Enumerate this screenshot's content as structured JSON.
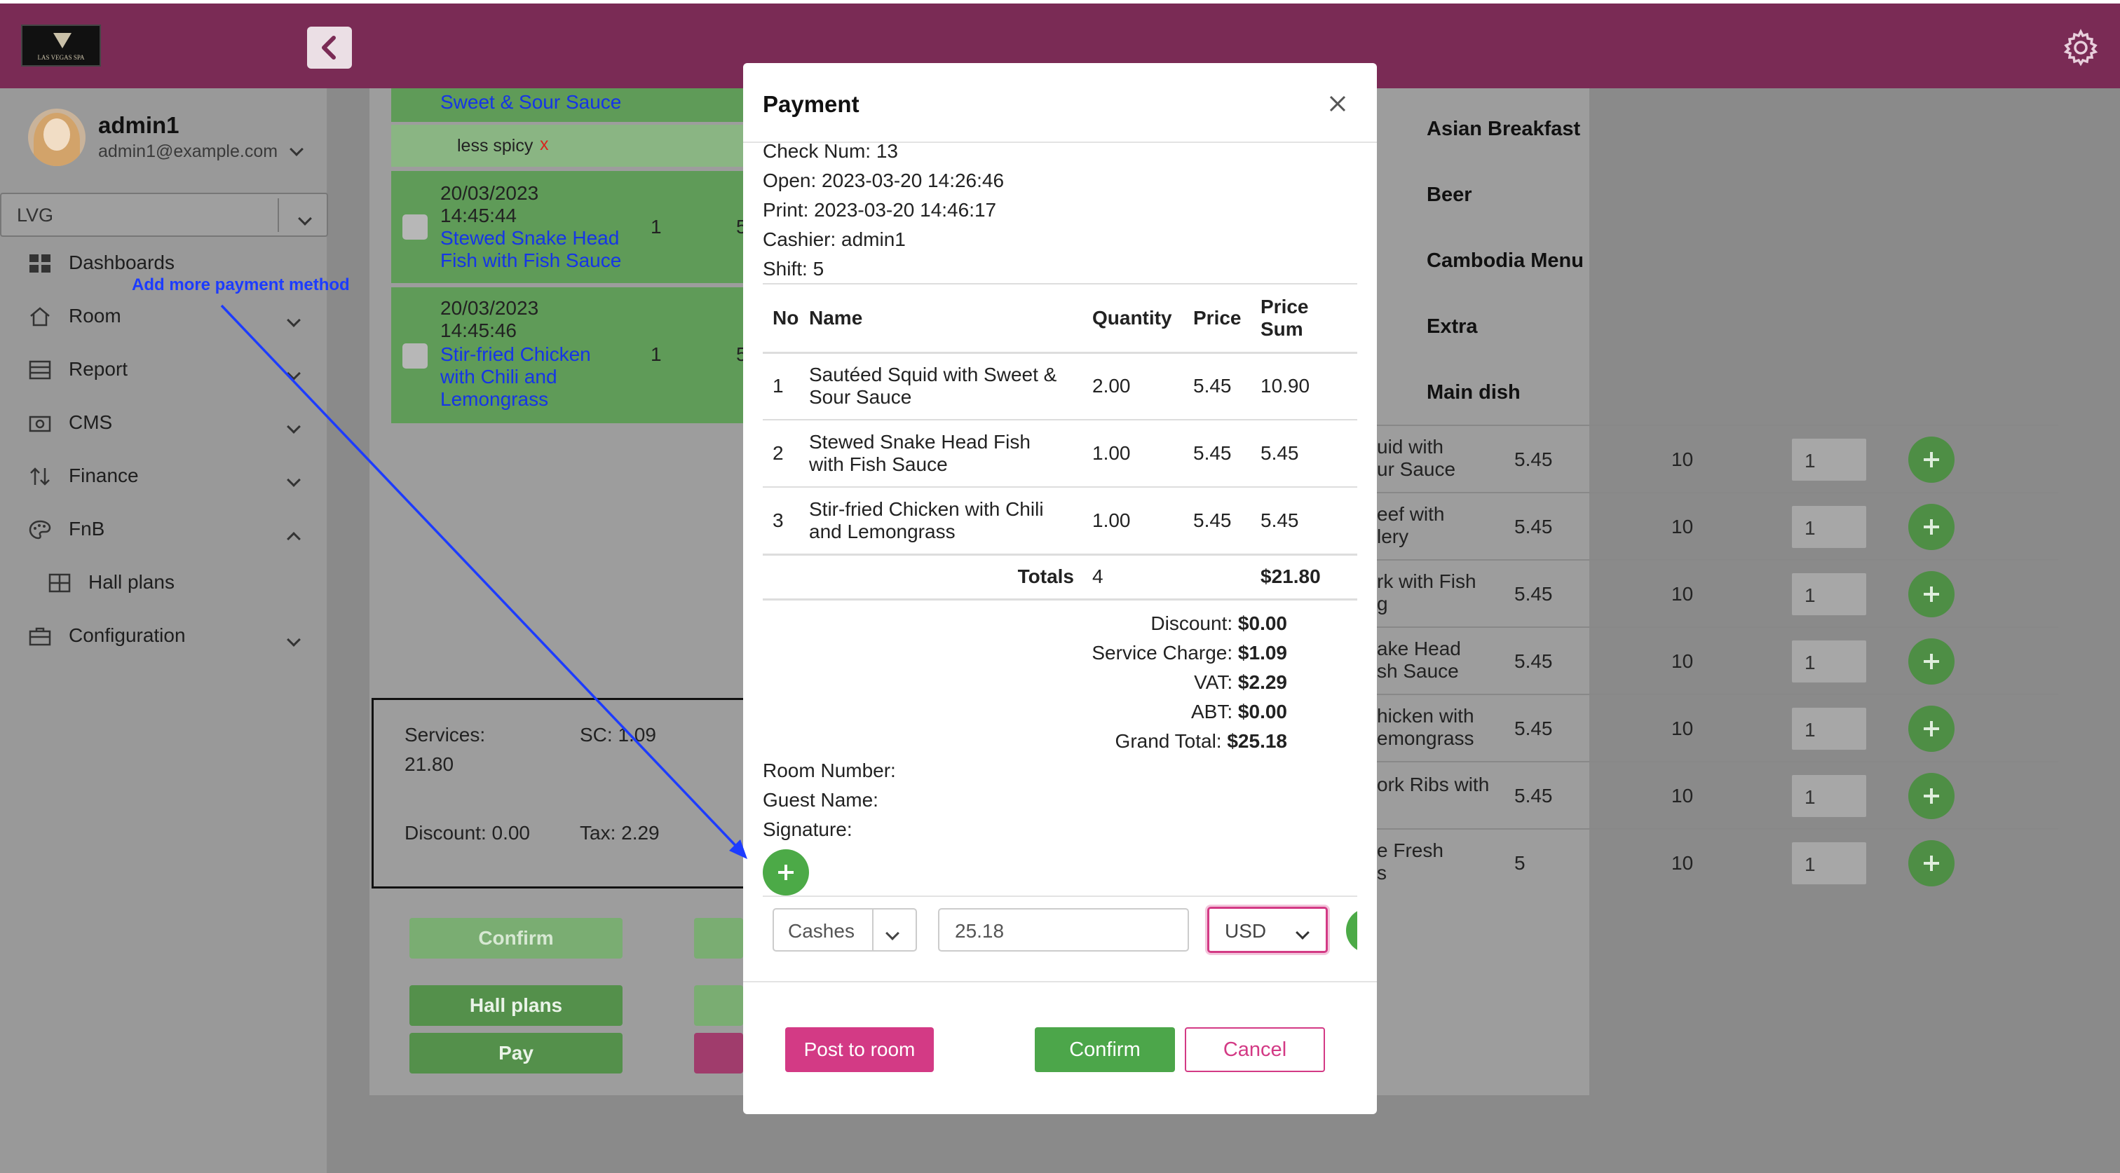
{
  "app": {
    "logo_text": "LAS VEGAS SPA"
  },
  "user": {
    "name": "admin1",
    "email": "admin1@example.com"
  },
  "location_select": {
    "value": "LVG"
  },
  "sidebar": {
    "items": [
      {
        "label": "Dashboards",
        "icon": "grid-icon"
      },
      {
        "label": "Room",
        "icon": "home-icon"
      },
      {
        "label": "Report",
        "icon": "report-icon"
      },
      {
        "label": "CMS",
        "icon": "camera-icon"
      },
      {
        "label": "Finance",
        "icon": "sort-icon"
      },
      {
        "label": "FnB",
        "icon": "palette-icon"
      },
      {
        "label": "Hall plans",
        "icon": "table-icon"
      },
      {
        "label": "Configuration",
        "icon": "briefcase-icon"
      }
    ]
  },
  "annotation": {
    "text": "Add more payment method",
    "color": "#1d3cff"
  },
  "orders": {
    "partial_item": "Sweet & Sour Sauce",
    "note": "less spicy",
    "note_remove": "x",
    "rows": [
      {
        "datetime": "20/03/2023 14:45:44",
        "date": "20/03/2023",
        "time": "14:45:44",
        "name_l1": "Stewed Snake Head",
        "name_l2": "Fish with Fish Sauce",
        "qty": "1",
        "price_partial": "5"
      },
      {
        "datetime": "20/03/2023 14:45:46",
        "date": "20/03/2023",
        "time": "14:45:46",
        "name_l1": "Stir-fried Chicken",
        "name_l2": "with Chili and",
        "name_l3": "Lemongrass",
        "qty": "1",
        "price_partial": "5"
      }
    ]
  },
  "summary": {
    "services_label": "Services:",
    "services_value": "21.80",
    "sc": "SC: 1.09",
    "discount": "Discount: 0.00",
    "tax": "Tax: 2.29"
  },
  "background_buttons": {
    "confirm": "Confirm",
    "hall_plans": "Hall plans",
    "pay": "Pay"
  },
  "menu": {
    "categories": [
      "Asian Breakfast",
      "Beer",
      "Cambodia Menu",
      "Extra",
      "Main dish"
    ],
    "items": [
      {
        "name_l1": "uid with",
        "name_l2": "ur Sauce",
        "price": "5.45",
        "stock": "10",
        "qty": "1"
      },
      {
        "name_l1": "eef with",
        "name_l2": "lery",
        "price": "5.45",
        "stock": "10",
        "qty": "1"
      },
      {
        "name_l1": "rk with Fish",
        "name_l2": "g",
        "price": "5.45",
        "stock": "10",
        "qty": "1"
      },
      {
        "name_l1": "ake Head",
        "name_l2": "sh Sauce",
        "price": "5.45",
        "stock": "10",
        "qty": "1"
      },
      {
        "name_l1": "hicken with",
        "name_l2": "emongrass",
        "price": "5.45",
        "stock": "10",
        "qty": "1"
      },
      {
        "name_l1": "ork Ribs with",
        "name_l2": "",
        "price": "5.45",
        "stock": "10",
        "qty": "1"
      },
      {
        "name_l1": "e Fresh",
        "name_l2": "s",
        "price": "5",
        "stock": "10",
        "qty": "1"
      }
    ]
  },
  "payment_modal": {
    "title": "Payment",
    "check_num": "Check Num: 13",
    "open": "Open: 2023-03-20 14:26:46",
    "print": "Print: 2023-03-20 14:46:17",
    "cashier": "Cashier: admin1",
    "shift": "Shift: 5",
    "table_headers": {
      "no": "No",
      "name": "Name",
      "quantity": "Quantity",
      "price": "Price",
      "price_sum_l1": "Price",
      "price_sum_l2": "Sum"
    },
    "rows": [
      {
        "no": "1",
        "name_l1": "Sautéed Squid with Sweet &",
        "name_l2": "Sour Sauce",
        "quantity": "2.00",
        "price": "5.45",
        "sum": "10.90"
      },
      {
        "no": "2",
        "name_l1": "Stewed Snake Head Fish",
        "name_l2": "with Fish Sauce",
        "quantity": "1.00",
        "price": "5.45",
        "sum": "5.45"
      },
      {
        "no": "3",
        "name_l1": "Stir-fried Chicken with Chili",
        "name_l2": "and Lemongrass",
        "quantity": "1.00",
        "price": "5.45",
        "sum": "5.45"
      }
    ],
    "totals": {
      "label": "Totals",
      "quantity": "4",
      "sum": "$21.80"
    },
    "discount": {
      "label": "Discount:",
      "value": "$0.00"
    },
    "service_charge": {
      "label": "Service Charge:",
      "value": "$1.09"
    },
    "vat": {
      "label": "VAT:",
      "value": "$2.29"
    },
    "abt": {
      "label": "ABT:",
      "value": "$0.00"
    },
    "grand_total": {
      "label": "Grand Total:",
      "value": "$25.18"
    },
    "room_number": "Room Number:",
    "guest_name": "Guest Name:",
    "signature": "Signature:",
    "payment_method": {
      "value": "Cashes"
    },
    "amount": {
      "value": "25.18"
    },
    "currency": {
      "value": "USD"
    },
    "buttons": {
      "post_to_room": "Post to room",
      "confirm": "Confirm",
      "cancel": "Cancel"
    }
  },
  "colors": {
    "header": "#7a2b55",
    "primary_green": "#4ca64a",
    "pink": "#d33a85",
    "link_blue": "#1535e6"
  }
}
